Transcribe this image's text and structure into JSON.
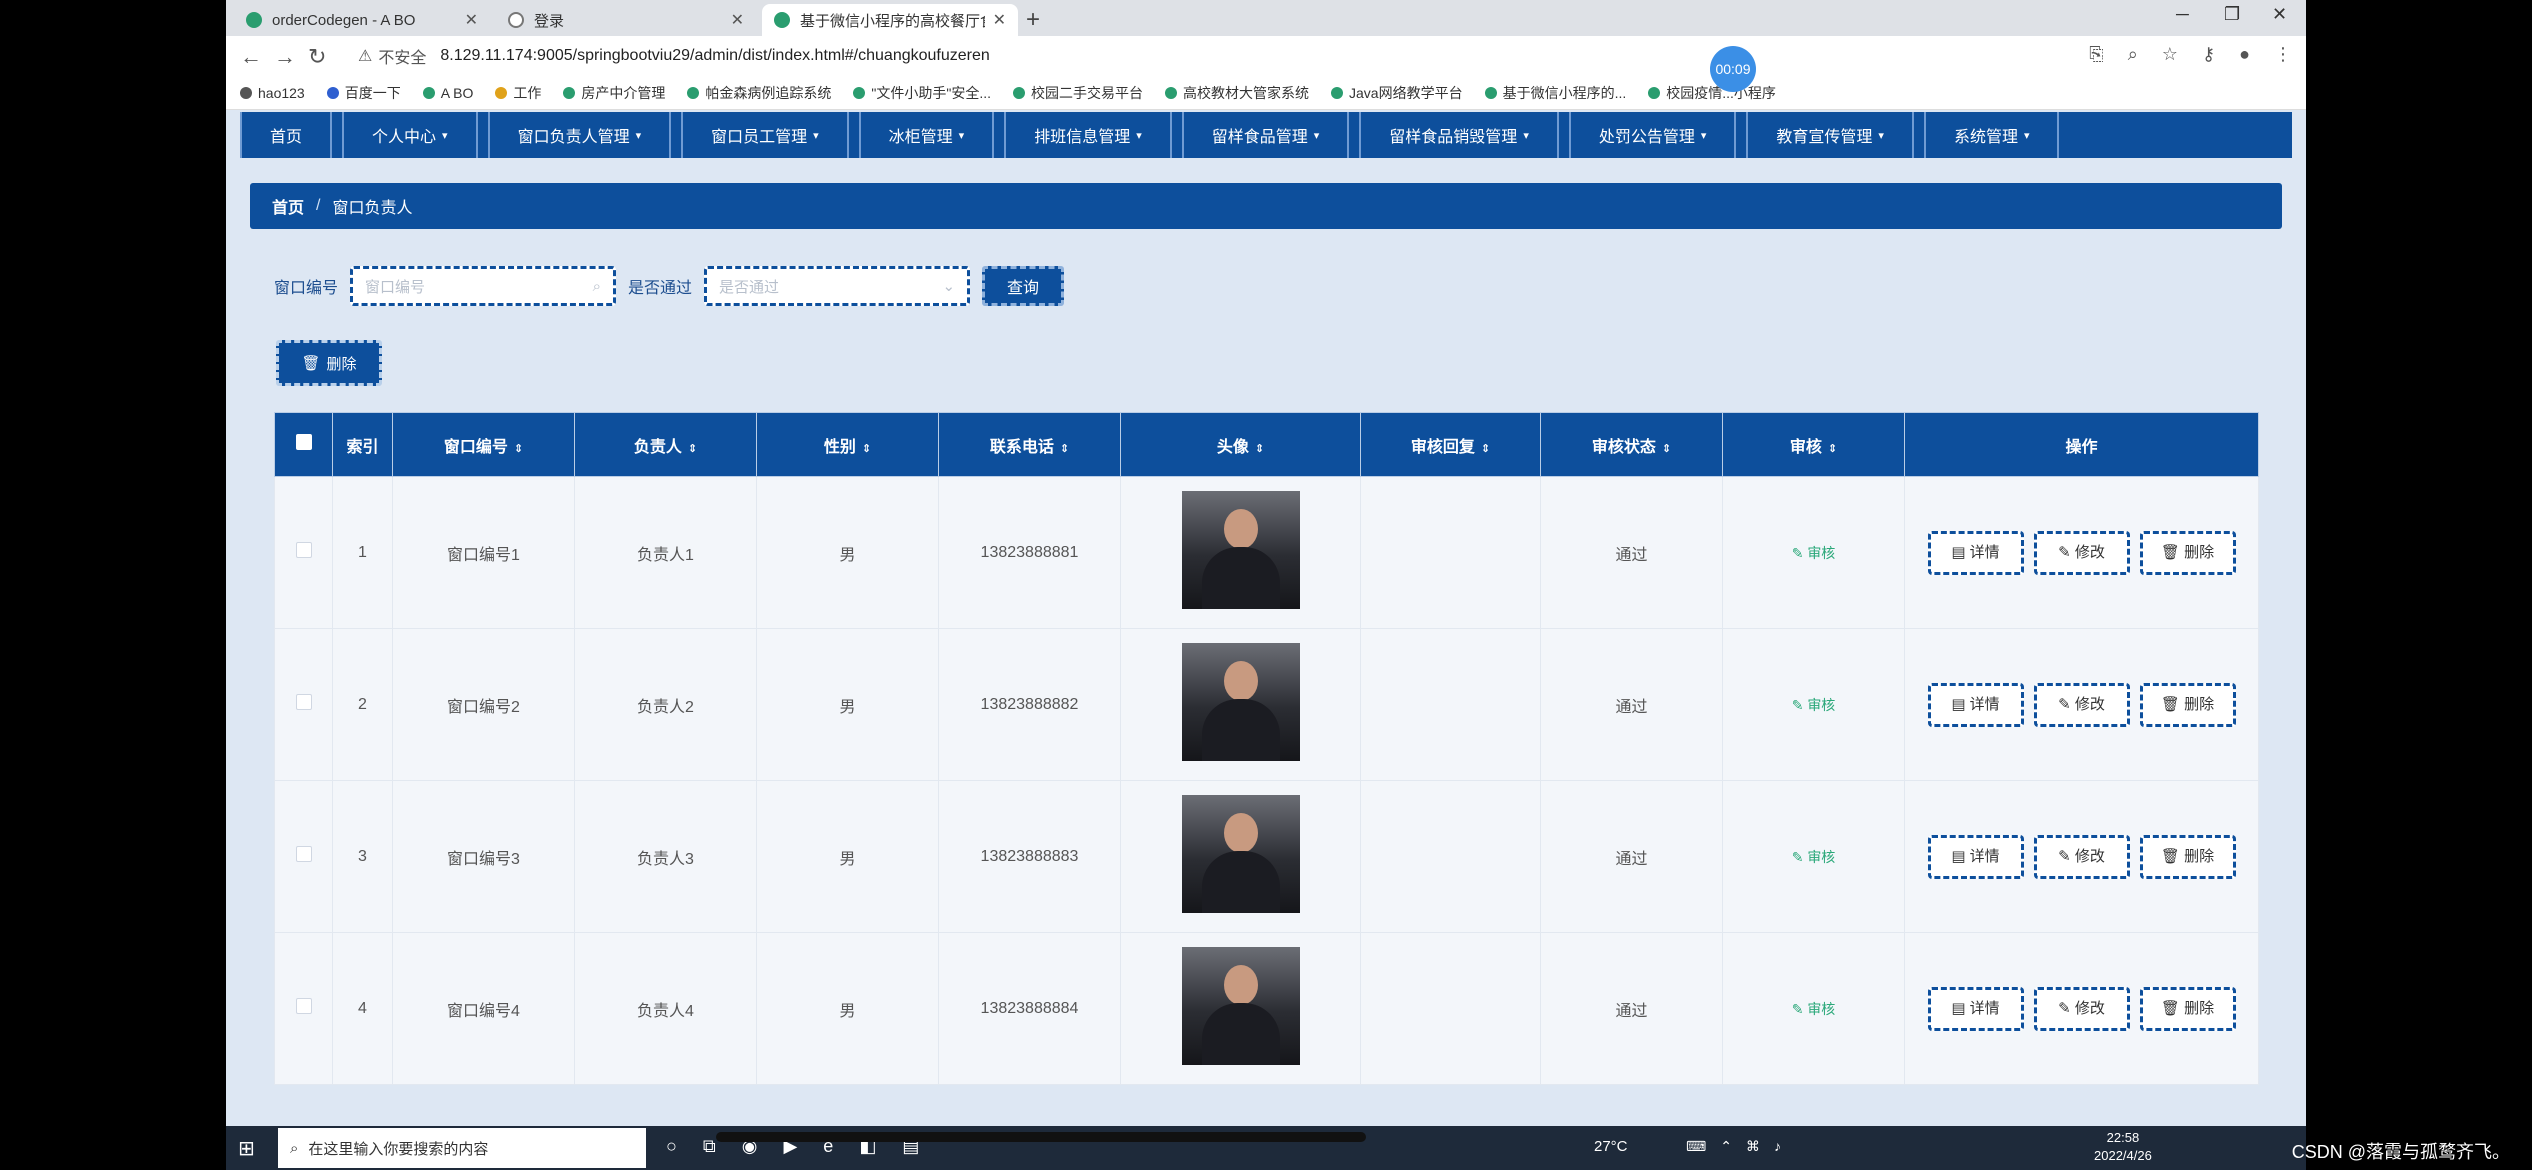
{
  "browser": {
    "tabs": [
      {
        "title": "orderCodegen - A BO",
        "color": "#2a9d6f"
      },
      {
        "title": "登录",
        "color": "#777"
      },
      {
        "title": "基于微信小程序的高校餐厅食品",
        "color": "#2a9d6f"
      }
    ],
    "insecure_label": "不安全",
    "url": "8.129.11.174:9005/springbootviu29/admin/dist/index.html#/chuangkoufuzeren",
    "bookmarks": [
      "hao123",
      "百度一下",
      "A BO",
      "工作",
      "房产中介管理",
      "帕金森病例追踪系统",
      "\"文件小助手\"安全...",
      "校园二手交易平台",
      "高校教材大管家系统",
      "Java网络教学平台",
      "基于微信小程序的...",
      "校园疫情...小程序"
    ],
    "recording_timer": "00:09"
  },
  "nav": [
    "首页",
    "个人中心",
    "窗口负责人管理",
    "窗口员工管理",
    "冰柜管理",
    "排班信息管理",
    "留样食品管理",
    "留样食品销毁管理",
    "处罚公告管理",
    "教育宣传管理",
    "系统管理"
  ],
  "breadcrumb": {
    "home": "首页",
    "sep": "/",
    "current": "窗口负责人"
  },
  "search": {
    "label1": "窗口编号",
    "placeholder1": "窗口编号",
    "label2": "是否通过",
    "placeholder2": "是否通过",
    "query": "查询"
  },
  "delete_button": "删除",
  "table": {
    "headers": [
      "索引",
      "窗口编号",
      "负责人",
      "性别",
      "联系电话",
      "头像",
      "审核回复",
      "审核状态",
      "审核",
      "操作"
    ],
    "rows": [
      {
        "idx": "1",
        "code": "窗口编号1",
        "person": "负责人1",
        "gender": "男",
        "phone": "13823888881",
        "reply": "",
        "status": "通过",
        "audit": "审核"
      },
      {
        "idx": "2",
        "code": "窗口编号2",
        "person": "负责人2",
        "gender": "男",
        "phone": "13823888882",
        "reply": "",
        "status": "通过",
        "audit": "审核"
      },
      {
        "idx": "3",
        "code": "窗口编号3",
        "person": "负责人3",
        "gender": "男",
        "phone": "13823888883",
        "reply": "",
        "status": "通过",
        "audit": "审核"
      },
      {
        "idx": "4",
        "code": "窗口编号4",
        "person": "负责人4",
        "gender": "男",
        "phone": "13823888884",
        "reply": "",
        "status": "通过",
        "audit": "审核"
      }
    ],
    "actions": {
      "detail": "详情",
      "edit": "修改",
      "delete": "删除"
    }
  },
  "taskbar": {
    "search_placeholder": "在这里输入你要搜索的内容",
    "temperature": "27°C",
    "time": "22:58",
    "date": "2022/4/26",
    "watermark": "CSDN @落霞与孤鹜齐飞。"
  }
}
